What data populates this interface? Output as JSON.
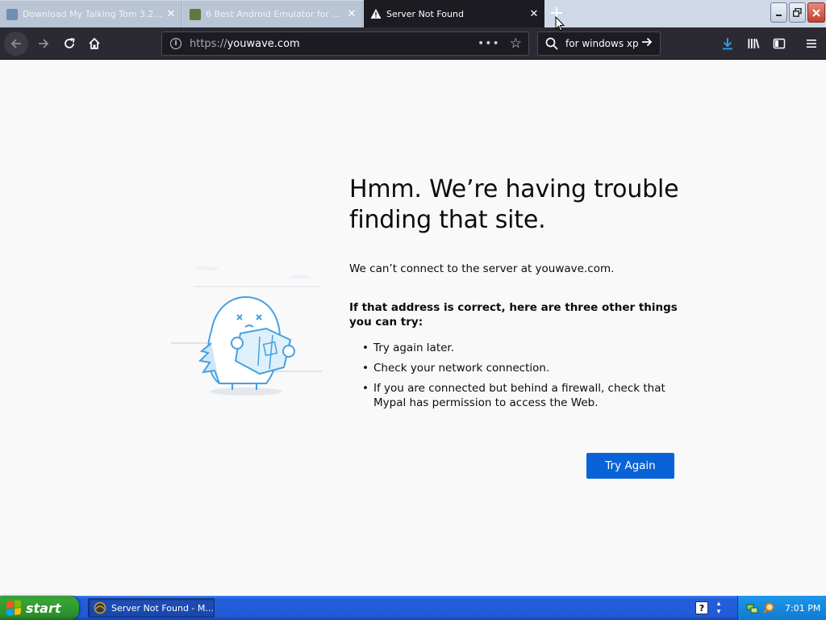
{
  "browser": {
    "tabs": [
      {
        "title": "Download My Talking Tom 3.2.1 ...",
        "active": false
      },
      {
        "title": "6 Best Android Emulator for Wind...",
        "active": false
      },
      {
        "title": "Server Not Found",
        "active": true
      }
    ],
    "new_tab_label": "+",
    "url": {
      "prefix": "https://",
      "host": "youwave.com"
    },
    "url_actions": "•••",
    "search_query": "for windows xp"
  },
  "error_page": {
    "title": "Hmm. We’re having trouble finding that site.",
    "description": "We can’t connect to the server at youwave.com.",
    "try_heading": "If that address is correct, here are three other things you can try:",
    "suggestions": [
      "Try again later.",
      "Check your network connection.",
      "If you are connected but behind a firewall, check that Mypal has permission to access the Web."
    ],
    "try_again_label": "Try Again"
  },
  "taskbar": {
    "start_label": "start",
    "task_label": "Server Not Found - M...",
    "help_glyph": "?",
    "clock": "7:01 PM"
  },
  "colors": {
    "accent_blue": "#0a63d6",
    "nav_bg": "#2b2a33",
    "active_tab_bg": "#1c1b22",
    "downloads_blue": "#2ea3f2",
    "illustration_blue": "#45a1e0",
    "xp_taskbar": "#245edb",
    "xp_start_green": "#35a535"
  },
  "icons": {
    "warning": "warning-icon",
    "back": "back-arrow-icon",
    "forward": "forward-arrow-icon",
    "reload": "reload-icon",
    "home": "home-icon",
    "info": "info-icon",
    "bookmark": "star-icon",
    "search": "search-icon",
    "go": "arrow-right-icon",
    "downloads": "download-icon",
    "library": "library-icon",
    "sidebar": "sidebar-icon",
    "menu": "hamburger-menu-icon"
  }
}
